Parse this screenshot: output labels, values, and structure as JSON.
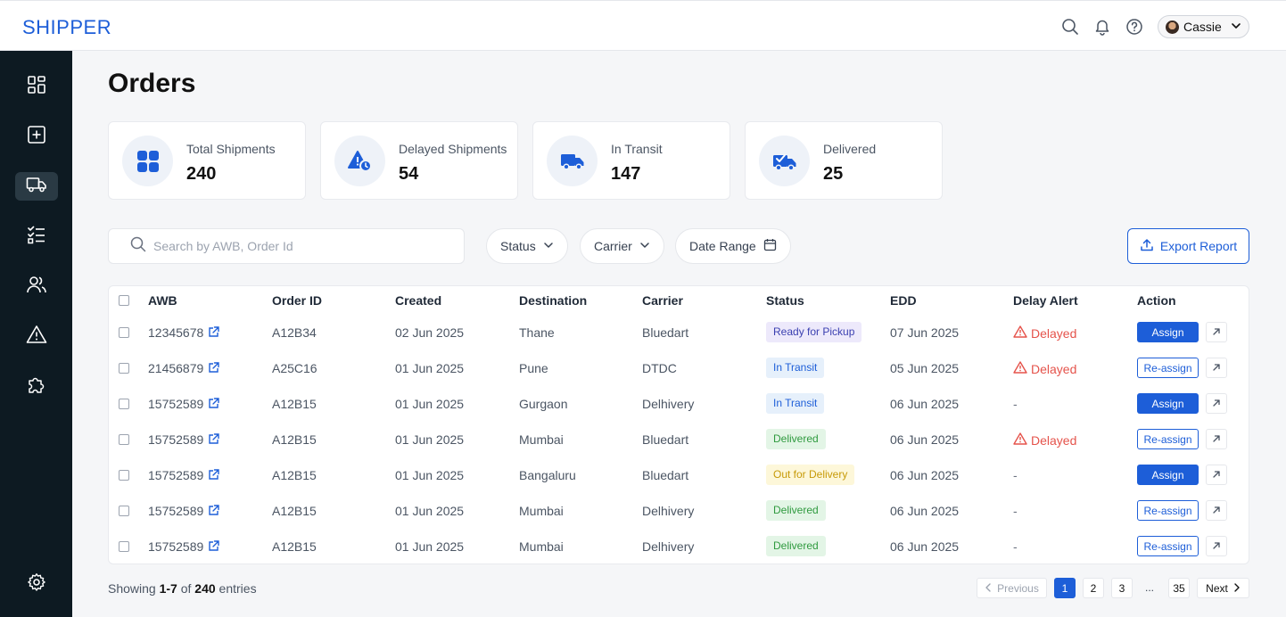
{
  "app": {
    "logo": "SHIPPER"
  },
  "header": {
    "user_name": "Cassie"
  },
  "page": {
    "title": "Orders"
  },
  "stats": [
    {
      "label": "Total Shipments",
      "value": "240",
      "icon": "grid-icon"
    },
    {
      "label": "Delayed Shipments",
      "value": "54",
      "icon": "alert-clock-icon"
    },
    {
      "label": "In Transit",
      "value": "147",
      "icon": "truck-icon"
    },
    {
      "label": "Delivered",
      "value": "25",
      "icon": "delivered-truck-icon"
    }
  ],
  "toolbar": {
    "search_placeholder": "Search by AWB, Order Id",
    "status_filter": "Status",
    "carrier_filter": "Carrier",
    "date_filter": "Date Range",
    "export_label": "Export Report"
  },
  "table": {
    "columns": [
      "AWB",
      "Order ID",
      "Created",
      "Destination",
      "Carrier",
      "Status",
      "EDD",
      "Delay Alert",
      "Action"
    ],
    "rows": [
      {
        "awb": "12345678",
        "order_id": "A12B34",
        "created": "02 Jun 2025",
        "destination": "Thane",
        "carrier": "Bluedart",
        "status": "Ready for Pickup",
        "edd": "07 Jun 2025",
        "delay": "Delayed",
        "action": "Assign"
      },
      {
        "awb": "21456879",
        "order_id": "A25C16",
        "created": "01 Jun 2025",
        "destination": "Pune",
        "carrier": "DTDC",
        "status": "In Transit",
        "edd": "05 Jun 2025",
        "delay": "Delayed",
        "action": "Re-assign"
      },
      {
        "awb": "15752589",
        "order_id": "A12B15",
        "created": "01 Jun 2025",
        "destination": "Gurgaon",
        "carrier": "Delhivery",
        "status": "In Transit",
        "edd": "06 Jun 2025",
        "delay": "-",
        "action": "Assign"
      },
      {
        "awb": "15752589",
        "order_id": "A12B15",
        "created": "01 Jun 2025",
        "destination": "Mumbai",
        "carrier": "Bluedart",
        "status": "Delivered",
        "edd": "06 Jun 2025",
        "delay": "Delayed",
        "action": "Re-assign"
      },
      {
        "awb": "15752589",
        "order_id": "A12B15",
        "created": "01 Jun 2025",
        "destination": "Bangaluru",
        "carrier": "Bluedart",
        "status": "Out for Delivery",
        "edd": "06 Jun 2025",
        "delay": "-",
        "action": "Assign"
      },
      {
        "awb": "15752589",
        "order_id": "A12B15",
        "created": "01 Jun 2025",
        "destination": "Mumbai",
        "carrier": "Delhivery",
        "status": "Delivered",
        "edd": "06 Jun 2025",
        "delay": "-",
        "action": "Re-assign"
      },
      {
        "awb": "15752589",
        "order_id": "A12B15",
        "created": "01 Jun 2025",
        "destination": "Mumbai",
        "carrier": "Delhivery",
        "status": "Delivered",
        "edd": "06 Jun 2025",
        "delay": "-",
        "action": "Re-assign"
      }
    ]
  },
  "footer": {
    "showing_prefix": "Showing",
    "showing_range": "1-7",
    "showing_of": "of",
    "showing_total": "240",
    "showing_suffix": "entries"
  },
  "pagination": {
    "previous": "Previous",
    "pages": [
      "1",
      "2",
      "3"
    ],
    "ellipsis": "...",
    "last": "35",
    "next": "Next",
    "current": "1"
  },
  "colors": {
    "brand": "#1d5ed8",
    "sidebar_bg": "#0d1a22",
    "delayed": "#e5534b"
  }
}
